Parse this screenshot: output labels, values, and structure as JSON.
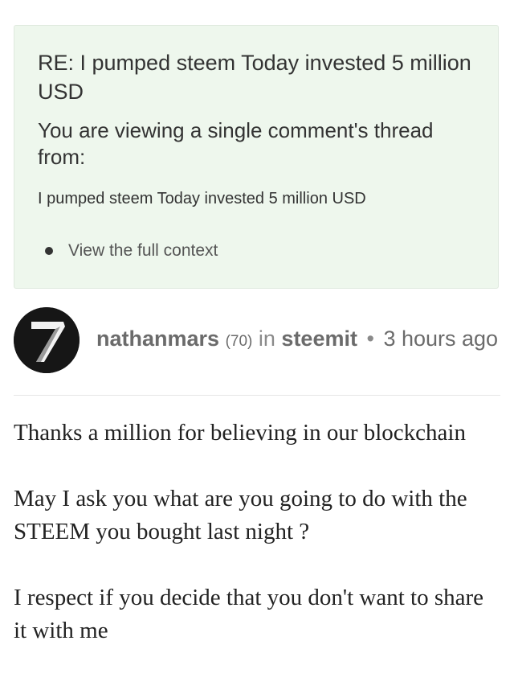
{
  "context": {
    "title": "RE: I pumped steem Today invested 5 million USD",
    "viewing_notice": "You are viewing a single comment's thread from:",
    "parent_title": "I pumped steem Today invested 5 million USD",
    "full_context_link": "View the full context"
  },
  "author": {
    "avatar_icon": "seven-logo-icon",
    "name": "nathanmars",
    "reputation": "(70)",
    "in_word": "in",
    "category": "steemit",
    "separator": "•",
    "timestamp": "3 hours ago"
  },
  "comment": {
    "paragraphs": [
      "Thanks a million for believing in our blockchain",
      "May I ask you what are you going to do with the STEEM you bought last night ?",
      "I respect if you decide that you don't want to share it with me"
    ]
  },
  "colors": {
    "context_background": "#eef7ed",
    "text": "#333333",
    "muted": "#8a8a8a"
  }
}
